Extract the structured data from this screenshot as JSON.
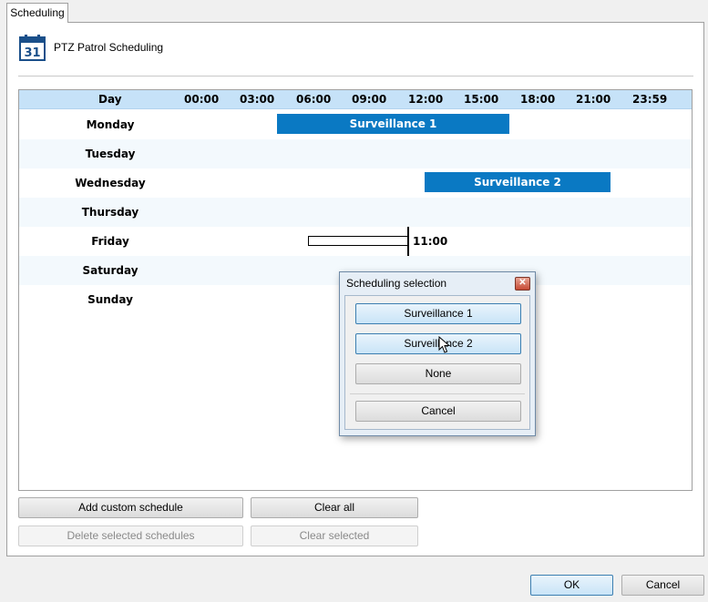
{
  "tab": {
    "label": "Scheduling"
  },
  "header": {
    "icon": "calendar-icon",
    "icon_text": "31",
    "title": "PTZ Patrol Scheduling"
  },
  "grid": {
    "day_header": "Day",
    "time_ticks": [
      "00:00",
      "03:00",
      "06:00",
      "09:00",
      "12:00",
      "15:00",
      "18:00",
      "21:00",
      "23:59"
    ],
    "days": [
      "Monday",
      "Tuesday",
      "Wednesday",
      "Thursday",
      "Friday",
      "Saturday",
      "Sunday"
    ],
    "schedules": [
      {
        "day": "Monday",
        "label": "Surveillance 1",
        "start_hour": 6.0,
        "end_hour": 18.3
      },
      {
        "day": "Wednesday",
        "label": "Surveillance 2",
        "start_hour": 12.0,
        "end_hour": 22.0
      }
    ],
    "pending_selection": {
      "day": "Friday",
      "start_hour": 5.7,
      "end_hour": 11.0,
      "time_label": "11:00"
    },
    "colors": {
      "header_bg": "#c6e2f8",
      "bar": "#0a79c3",
      "alt_row": "#f3f9fd"
    }
  },
  "buttons": {
    "add_custom": "Add custom schedule",
    "clear_all": "Clear all",
    "delete_selected": "Delete selected schedules",
    "clear_selected": "Clear selected"
  },
  "dialog": {
    "title": "Scheduling selection",
    "close_icon": "close-icon",
    "options": [
      "Surveillance 1",
      "Surveillance 2",
      "None"
    ],
    "cancel": "Cancel"
  },
  "footer": {
    "ok": "OK",
    "cancel": "Cancel"
  }
}
